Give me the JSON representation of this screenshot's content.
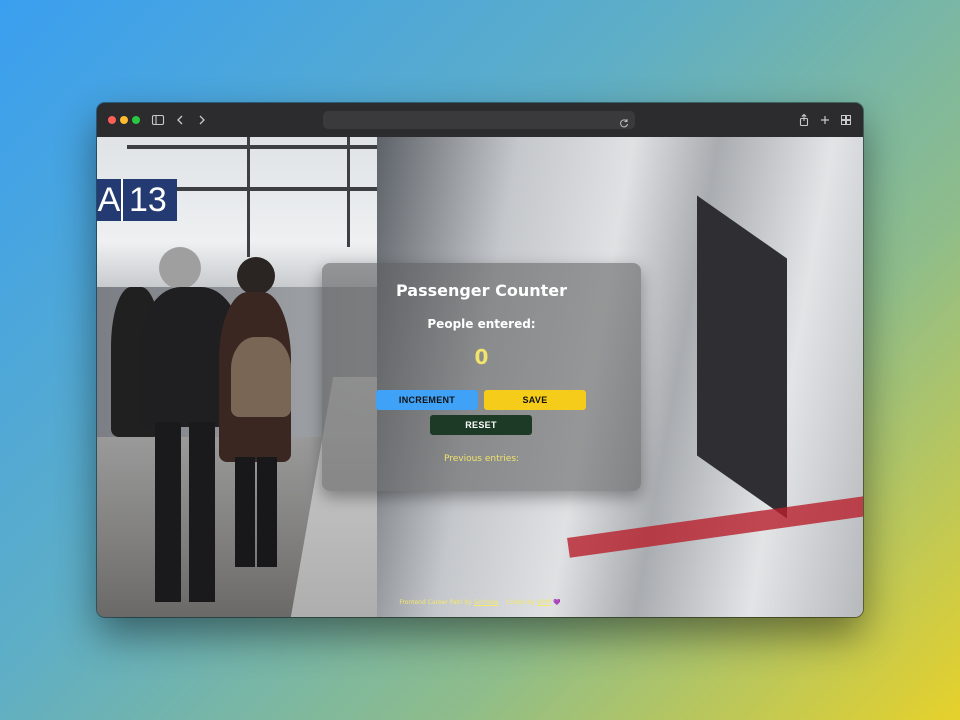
{
  "browser": {
    "address": "",
    "icons": {
      "sidebar": "sidebar-icon",
      "back": "chevron-left-icon",
      "forward": "chevron-right-icon",
      "reload": "reload-icon",
      "share": "share-icon",
      "new_tab": "plus-icon",
      "tabs": "tab-overview-icon"
    }
  },
  "background_sign": {
    "letter": "A",
    "number": "13"
  },
  "app": {
    "title": "Passenger Counter",
    "subtitle": "People entered:",
    "count": "0",
    "buttons": {
      "increment": "INCREMENT",
      "save": "SAVE",
      "reset": "RESET"
    },
    "previous_label": "Previous entries:"
  },
  "footer": {
    "prefix": "Frontend Career Path by",
    "link1": "Scrimba",
    "middle": "Coded by",
    "link2": "VIMP",
    "heart": "💜"
  },
  "colors": {
    "increment": "#3fa2f7",
    "save": "#f4cc19",
    "reset": "#1d3a27",
    "accent_text": "#f2e36b"
  }
}
